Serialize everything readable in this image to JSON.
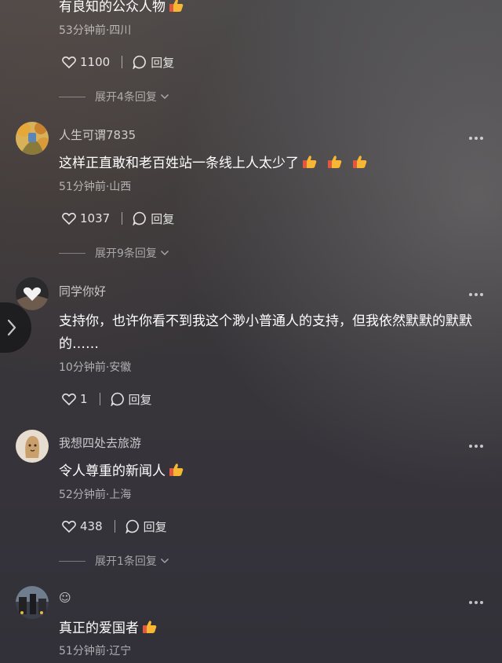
{
  "comments": [
    {
      "text": "有良知的公众人物",
      "meta": "53分钟前·四川",
      "likes": "1100",
      "reply_label": "回复",
      "expand_label": "展开4条回复"
    },
    {
      "username": "人生可谓7835",
      "text": "这样正直敢和老百姓站一条线上人太少了",
      "meta": "51分钟前·山西",
      "likes": "1037",
      "reply_label": "回复",
      "expand_label": "展开9条回复"
    },
    {
      "username": "同学你好",
      "text": "支持你，也许你看不到我这个渺小普通人的支持，但我依然默默的默默的……",
      "meta": "10分钟前·安徽",
      "likes": "1",
      "reply_label": "回复"
    },
    {
      "username": "我想四处去旅游",
      "text": "令人尊重的新闻人",
      "meta": "52分钟前·上海",
      "likes": "438",
      "reply_label": "回复",
      "expand_label": "展开1条回复"
    },
    {
      "username": "☺",
      "text": "真正的爱国者",
      "meta": "51分钟前·辽宁"
    }
  ],
  "colors": {
    "thumb": "#f7b733",
    "thumb_cuff": "#e4573f"
  }
}
